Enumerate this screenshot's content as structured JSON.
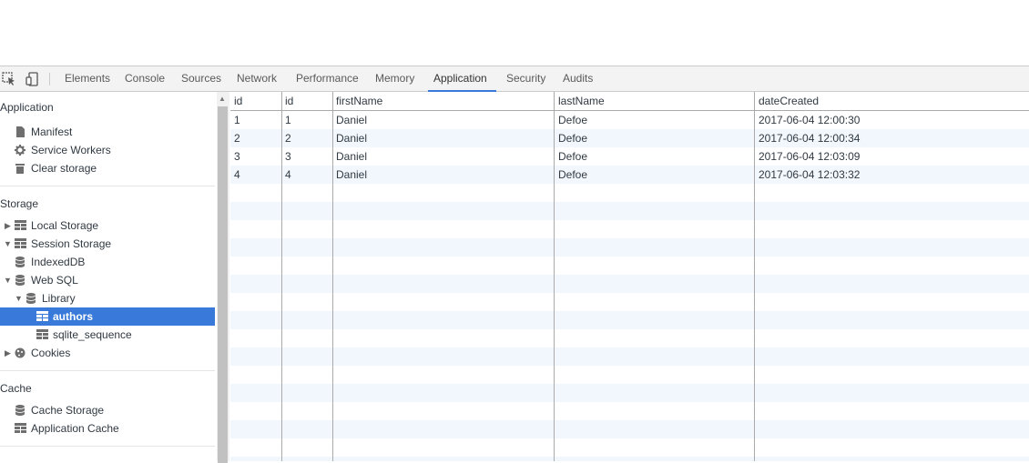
{
  "toolbar": {
    "tabs": [
      {
        "label": "Elements"
      },
      {
        "label": "Console"
      },
      {
        "label": "Sources"
      },
      {
        "label": "Network"
      },
      {
        "label": "Performance"
      },
      {
        "label": "Memory"
      },
      {
        "label": "Application"
      },
      {
        "label": "Security"
      },
      {
        "label": "Audits"
      }
    ],
    "active_tab": "Application"
  },
  "sidebar": {
    "application": {
      "title": "Application",
      "items": [
        {
          "label": "Manifest",
          "icon": "document-icon"
        },
        {
          "label": "Service Workers",
          "icon": "gear-icon"
        },
        {
          "label": "Clear storage",
          "icon": "trash-icon"
        }
      ]
    },
    "storage": {
      "title": "Storage",
      "items": [
        {
          "label": "Local Storage",
          "icon": "table-icon",
          "expander": "collapsed"
        },
        {
          "label": "Session Storage",
          "icon": "table-icon",
          "expander": "expanded"
        },
        {
          "label": "IndexedDB",
          "icon": "database-icon"
        },
        {
          "label": "Web SQL",
          "icon": "database-icon",
          "expander": "expanded"
        },
        {
          "label": "Library",
          "icon": "database-icon",
          "expander": "expanded"
        },
        {
          "label": "authors",
          "icon": "table-icon",
          "selected": true
        },
        {
          "label": "sqlite_sequence",
          "icon": "table-icon"
        },
        {
          "label": "Cookies",
          "icon": "cookie-icon",
          "expander": "collapsed"
        }
      ]
    },
    "cache": {
      "title": "Cache",
      "items": [
        {
          "label": "Cache Storage",
          "icon": "database-icon"
        },
        {
          "label": "Application Cache",
          "icon": "table-icon"
        }
      ]
    }
  },
  "table": {
    "columns": [
      "id",
      "id",
      "firstName",
      "lastName",
      "dateCreated"
    ],
    "rows": [
      [
        "1",
        "1",
        "Daniel",
        "Defoe",
        "2017-06-04 12:00:30"
      ],
      [
        "2",
        "2",
        "Daniel",
        "Defoe",
        "2017-06-04 12:00:34"
      ],
      [
        "3",
        "3",
        "Daniel",
        "Defoe",
        "2017-06-04 12:03:09"
      ],
      [
        "4",
        "4",
        "Daniel",
        "Defoe",
        "2017-06-04 12:03:32"
      ]
    ]
  },
  "colors": {
    "accent": "#3879d9",
    "selected_row_bg": "#3879d9",
    "alt_row_bg": "#f2f7fd"
  }
}
